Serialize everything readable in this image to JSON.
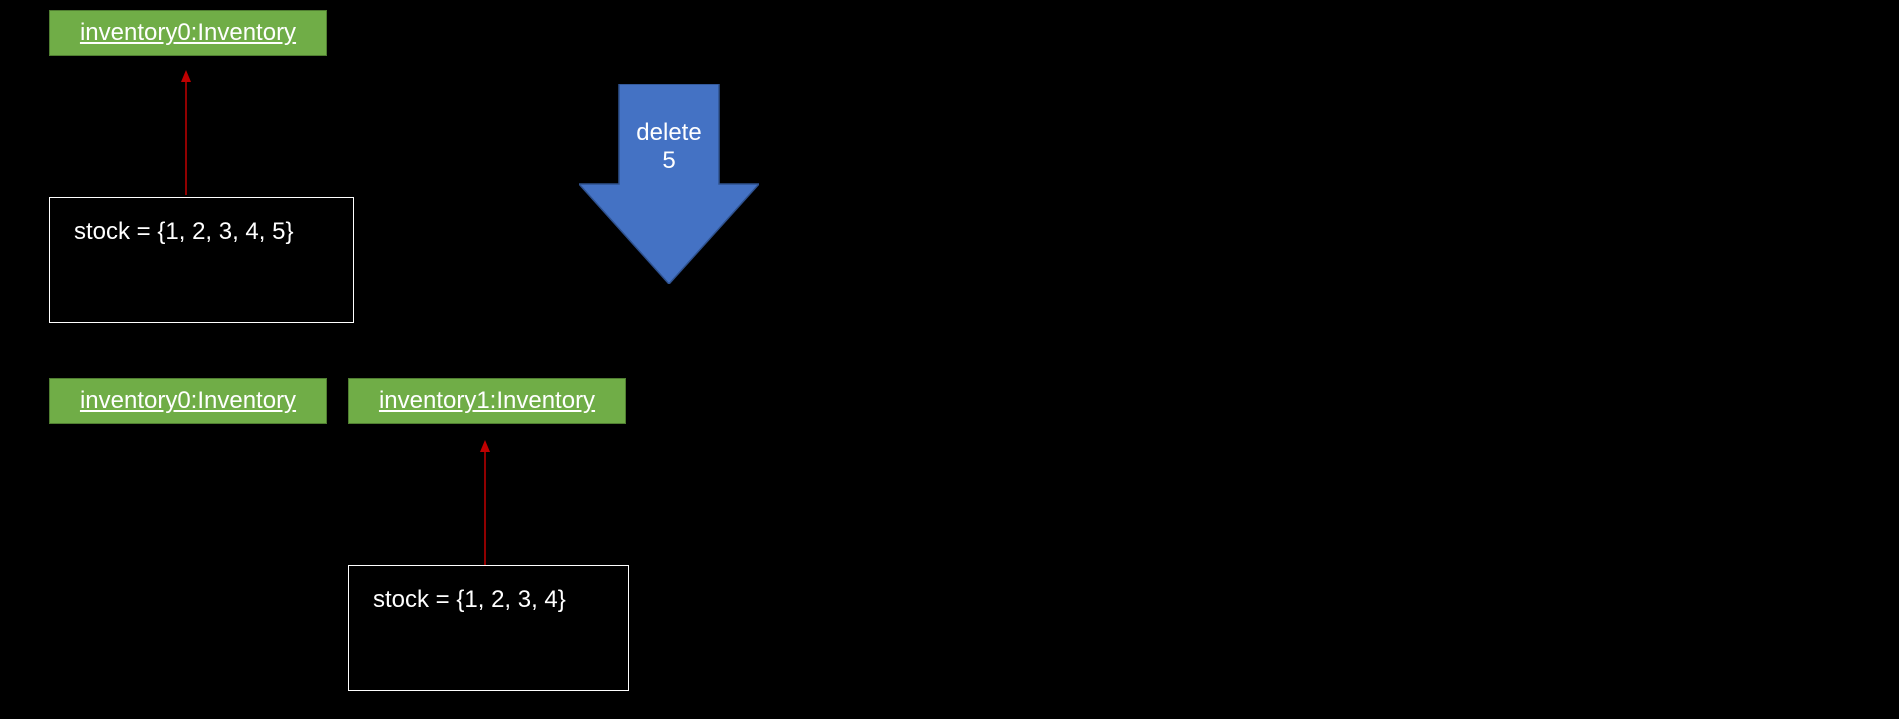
{
  "before": {
    "objects": [
      {
        "label": "inventory0:Inventory"
      }
    ],
    "comment": "stock = {1, 2, 3, 4, 5}"
  },
  "operation": {
    "action": "delete",
    "value": "5"
  },
  "after": {
    "objects": [
      {
        "label": "inventory0:Inventory"
      },
      {
        "label": "inventory1:Inventory"
      }
    ],
    "comment": "stock = {1, 2, 3, 4}"
  }
}
